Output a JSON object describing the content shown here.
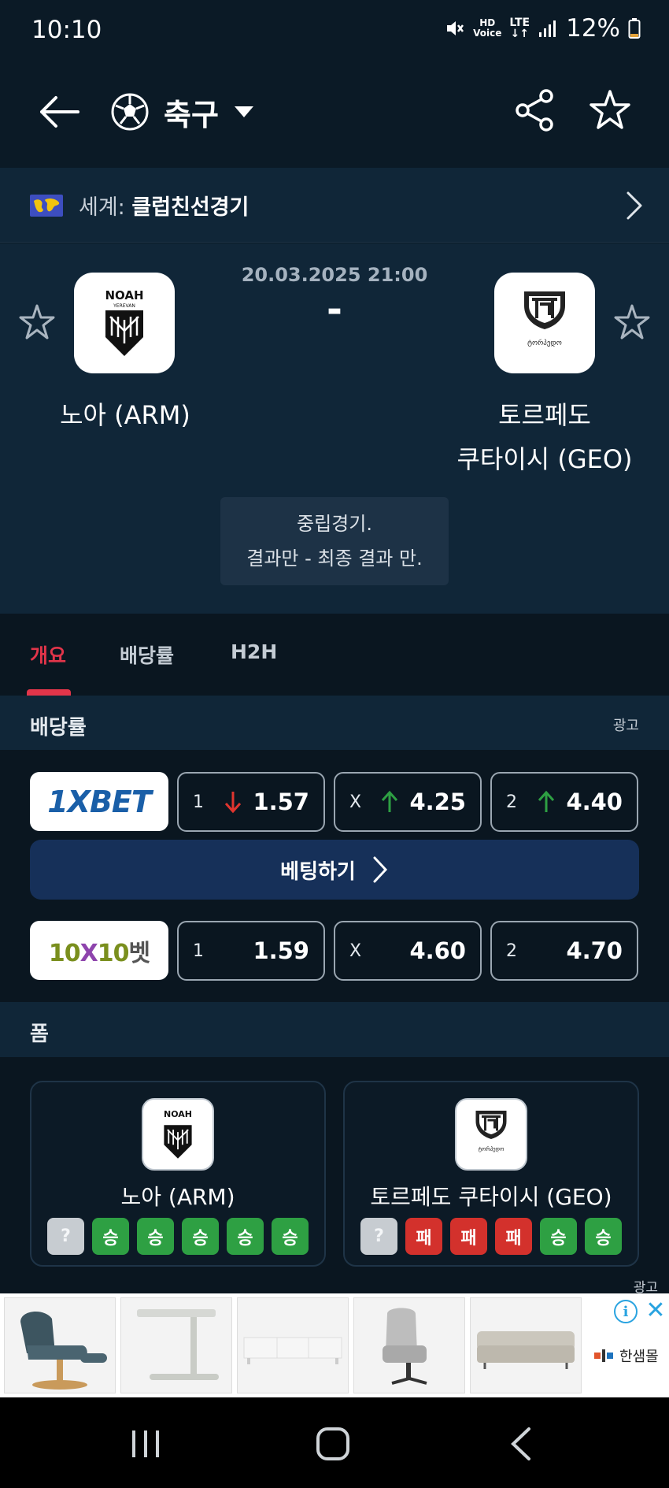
{
  "status_bar": {
    "time": "10:10",
    "battery": "12%",
    "hd_line1": "HD",
    "hd_line2": "Voice",
    "lte": "LTE"
  },
  "app_bar": {
    "sport": "축구",
    "icons": [
      "back-arrow-icon",
      "soccer-ball-icon",
      "dropdown-caret-icon",
      "share-icon",
      "star-icon"
    ]
  },
  "league": {
    "prefix": "세계: ",
    "name": "클럽친선경기"
  },
  "match": {
    "datetime": "20.03.2025 21:00",
    "score": "-",
    "home": {
      "name": "노아 (ARM)",
      "logo_text": "NOAH",
      "logo_sub": "YEREVAN"
    },
    "away": {
      "name_line1": "토르페도",
      "name_line2": "쿠타이시 (GEO)",
      "logo_text": "ტორპედო"
    },
    "notice_line1": "중립경기.",
    "notice_line2": "결과만 - 최종 결과 만."
  },
  "tabs": [
    {
      "label": "개요"
    },
    {
      "label": "배당률"
    },
    {
      "label": "H2H"
    }
  ],
  "odds": {
    "title": "배당률",
    "ad_label": "광고",
    "bet_button": "베팅하기",
    "bookmakers": [
      {
        "name": "1XBET",
        "odds": [
          {
            "key": "1",
            "value": "1.57",
            "trend": "down"
          },
          {
            "key": "X",
            "value": "4.25",
            "trend": "up"
          },
          {
            "key": "2",
            "value": "4.40",
            "trend": "up"
          }
        ]
      },
      {
        "name_a": "10",
        "name_x": "X",
        "name_b": "10",
        "name_c": "벳",
        "odds": [
          {
            "key": "1",
            "value": "1.59"
          },
          {
            "key": "X",
            "value": "4.60"
          },
          {
            "key": "2",
            "value": "4.70"
          }
        ]
      }
    ]
  },
  "form": {
    "title": "폼",
    "home": {
      "name": "노아 (ARM)",
      "results": [
        "?",
        "승",
        "승",
        "승",
        "승",
        "승"
      ]
    },
    "away": {
      "name": "토르페도 쿠타이시 (GEO)",
      "results": [
        "?",
        "패",
        "패",
        "패",
        "승",
        "승"
      ]
    }
  },
  "banner": {
    "ad_label": "광고",
    "brand": "한샘몰",
    "info": "i",
    "close": "✕"
  },
  "colors": {
    "win": "#2ea043",
    "loss": "#d3312c",
    "accent": "#e2354a",
    "bet_button": "#163059"
  }
}
